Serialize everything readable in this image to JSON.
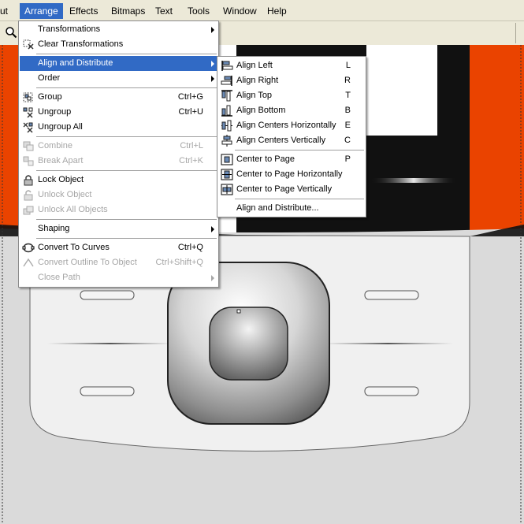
{
  "menubar": {
    "items": [
      {
        "label": "ut"
      },
      {
        "label": "Arrange"
      },
      {
        "label": "Effects"
      },
      {
        "label": "Bitmaps"
      },
      {
        "label": "Text"
      },
      {
        "label": "Tools"
      },
      {
        "label": "Window"
      },
      {
        "label": "Help"
      }
    ]
  },
  "arrange_menu": {
    "items": [
      {
        "label": "Transformations",
        "shortcut": "",
        "submenu": true,
        "disabled": false,
        "icon": ""
      },
      {
        "label": "Clear Transformations",
        "shortcut": "",
        "submenu": false,
        "disabled": false,
        "icon": "clear-transform-icon"
      },
      {
        "label": "Align and Distribute",
        "shortcut": "",
        "submenu": true,
        "disabled": false,
        "icon": "",
        "highlighted": true
      },
      {
        "label": "Order",
        "shortcut": "",
        "submenu": true,
        "disabled": false,
        "icon": ""
      },
      {
        "label": "Group",
        "shortcut": "Ctrl+G",
        "submenu": false,
        "disabled": false,
        "icon": "group-icon"
      },
      {
        "label": "Ungroup",
        "shortcut": "Ctrl+U",
        "submenu": false,
        "disabled": false,
        "icon": "ungroup-icon"
      },
      {
        "label": "Ungroup All",
        "shortcut": "",
        "submenu": false,
        "disabled": false,
        "icon": "ungroup-all-icon"
      },
      {
        "label": "Combine",
        "shortcut": "Ctrl+L",
        "submenu": false,
        "disabled": true,
        "icon": "combine-icon"
      },
      {
        "label": "Break Apart",
        "shortcut": "Ctrl+K",
        "submenu": false,
        "disabled": true,
        "icon": "break-apart-icon"
      },
      {
        "label": "Lock Object",
        "shortcut": "",
        "submenu": false,
        "disabled": false,
        "icon": "lock-icon"
      },
      {
        "label": "Unlock Object",
        "shortcut": "",
        "submenu": false,
        "disabled": true,
        "icon": "unlock-icon"
      },
      {
        "label": "Unlock All Objects",
        "shortcut": "",
        "submenu": false,
        "disabled": true,
        "icon": "unlock-all-icon"
      },
      {
        "label": "Shaping",
        "shortcut": "",
        "submenu": true,
        "disabled": false,
        "icon": ""
      },
      {
        "label": "Convert To Curves",
        "shortcut": "Ctrl+Q",
        "submenu": false,
        "disabled": false,
        "icon": "convert-curves-icon"
      },
      {
        "label": "Convert Outline To Object",
        "shortcut": "Ctrl+Shift+Q",
        "submenu": false,
        "disabled": true,
        "icon": "convert-outline-icon"
      },
      {
        "label": "Close Path",
        "shortcut": "",
        "submenu": true,
        "disabled": true,
        "icon": ""
      }
    ]
  },
  "align_submenu": {
    "items": [
      {
        "label": "Align Left",
        "shortcut": "L",
        "icon": "align-left-icon"
      },
      {
        "label": "Align Right",
        "shortcut": "R",
        "icon": "align-right-icon"
      },
      {
        "label": "Align Top",
        "shortcut": "T",
        "icon": "align-top-icon"
      },
      {
        "label": "Align Bottom",
        "shortcut": "B",
        "icon": "align-bottom-icon"
      },
      {
        "label": "Align Centers Horizontally",
        "shortcut": "E",
        "icon": "align-centers-h-icon"
      },
      {
        "label": "Align Centers Vertically",
        "shortcut": "C",
        "icon": "align-centers-v-icon"
      },
      {
        "label": "Center to Page",
        "shortcut": "P",
        "icon": "center-page-icon"
      },
      {
        "label": "Center to Page Horizontally",
        "shortcut": "",
        "icon": "center-page-h-icon"
      },
      {
        "label": "Center to Page Vertically",
        "shortcut": "",
        "icon": "center-page-v-icon"
      },
      {
        "label": "Align and Distribute...",
        "shortcut": "",
        "icon": ""
      }
    ]
  },
  "colors": {
    "accent": "#316ac5",
    "artwork_orange": "#ea4300",
    "menubar_bg": "#ece9d8"
  }
}
